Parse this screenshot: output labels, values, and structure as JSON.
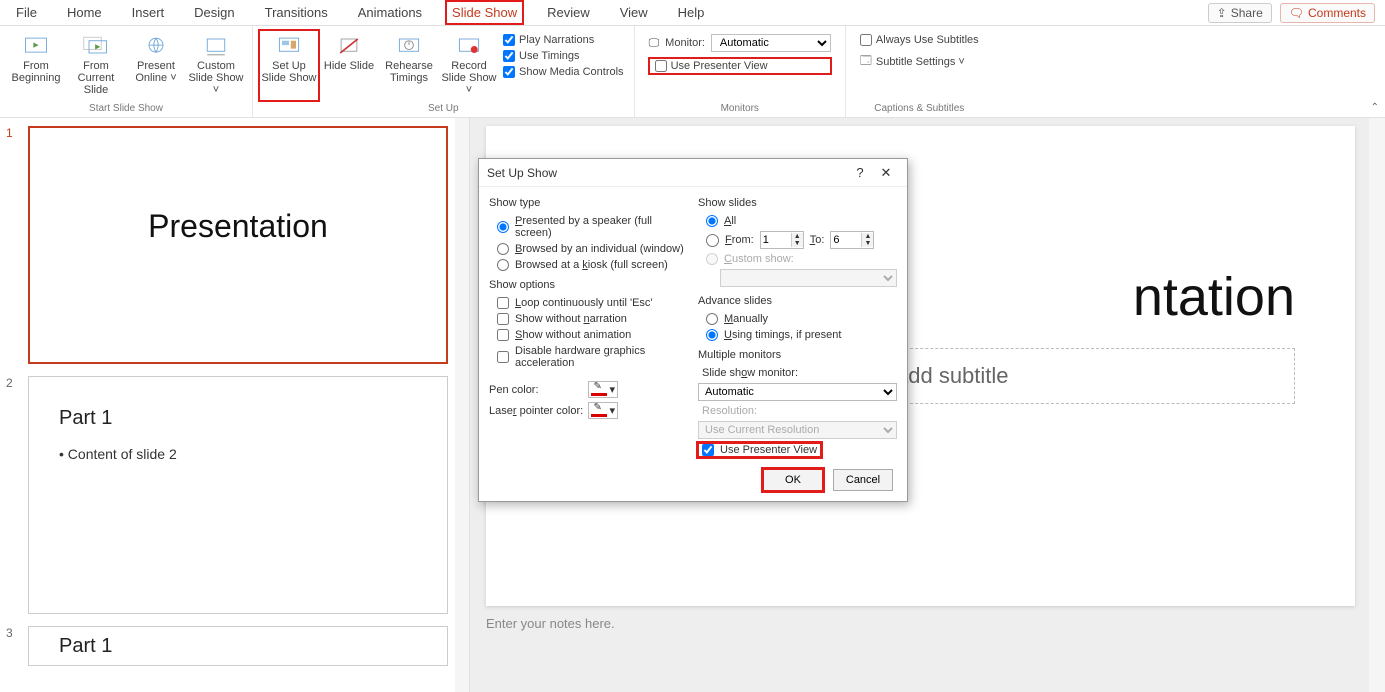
{
  "menu": {
    "items": [
      "File",
      "Home",
      "Insert",
      "Design",
      "Transitions",
      "Animations",
      "Slide Show",
      "Review",
      "View",
      "Help"
    ],
    "active": "Slide Show",
    "share": "Share",
    "comments": "Comments"
  },
  "ribbon": {
    "start": {
      "from_beginning": "From Beginning",
      "from_current": "From Current Slide",
      "present_online": "Present Online ˅",
      "custom_show": "Custom Slide Show ˅",
      "group": "Start Slide Show"
    },
    "setup": {
      "setup_show": "Set Up Slide Show",
      "hide_slide": "Hide Slide",
      "rehearse": "Rehearse Timings",
      "record": "Record Slide Show ˅",
      "play_narrations": "Play Narrations",
      "use_timings": "Use Timings",
      "show_media": "Show Media Controls",
      "group": "Set Up"
    },
    "monitors": {
      "monitor_label": "Monitor:",
      "monitor_value": "Automatic",
      "use_presenter": "Use Presenter View",
      "group": "Monitors"
    },
    "captions": {
      "always_subtitles": "Always Use Subtitles",
      "subtitle_settings": "Subtitle Settings ˅",
      "group": "Captions & Subtitles"
    }
  },
  "thumbs": {
    "t1_title": "Presentation",
    "t2_h": "Part 1",
    "t2_b": "• Content of slide 2",
    "t3_h": "Part 1"
  },
  "slide": {
    "title": "ntation",
    "subtitle_placeholder": "add subtitle",
    "notes_placeholder": "Enter your notes here."
  },
  "dialog": {
    "title": "Set Up Show",
    "show_type": "Show type",
    "opt_presented": "Presented by a speaker (full screen)",
    "opt_browsed_ind": "Browsed by an individual (window)",
    "opt_browsed_kiosk": "Browsed at a kiosk (full screen)",
    "show_options": "Show options",
    "loop": "Loop continuously until 'Esc'",
    "no_narration": "Show without narration",
    "no_animation": "Show without animation",
    "disable_hw": "Disable hardware graphics acceleration",
    "pen_color": "Pen color:",
    "laser_color": "Laser pointer color:",
    "show_slides": "Show slides",
    "all": "All",
    "from": "From:",
    "to": "To:",
    "from_val": "1",
    "to_val": "6",
    "custom_show": "Custom show:",
    "advance": "Advance slides",
    "manually": "Manually",
    "using_timings": "Using timings, if present",
    "multi_mon": "Multiple monitors",
    "slide_mon": "Slide show monitor:",
    "mon_value": "Automatic",
    "resolution": "Resolution:",
    "res_value": "Use Current Resolution",
    "use_presenter": "Use Presenter View",
    "ok": "OK",
    "cancel": "Cancel"
  }
}
